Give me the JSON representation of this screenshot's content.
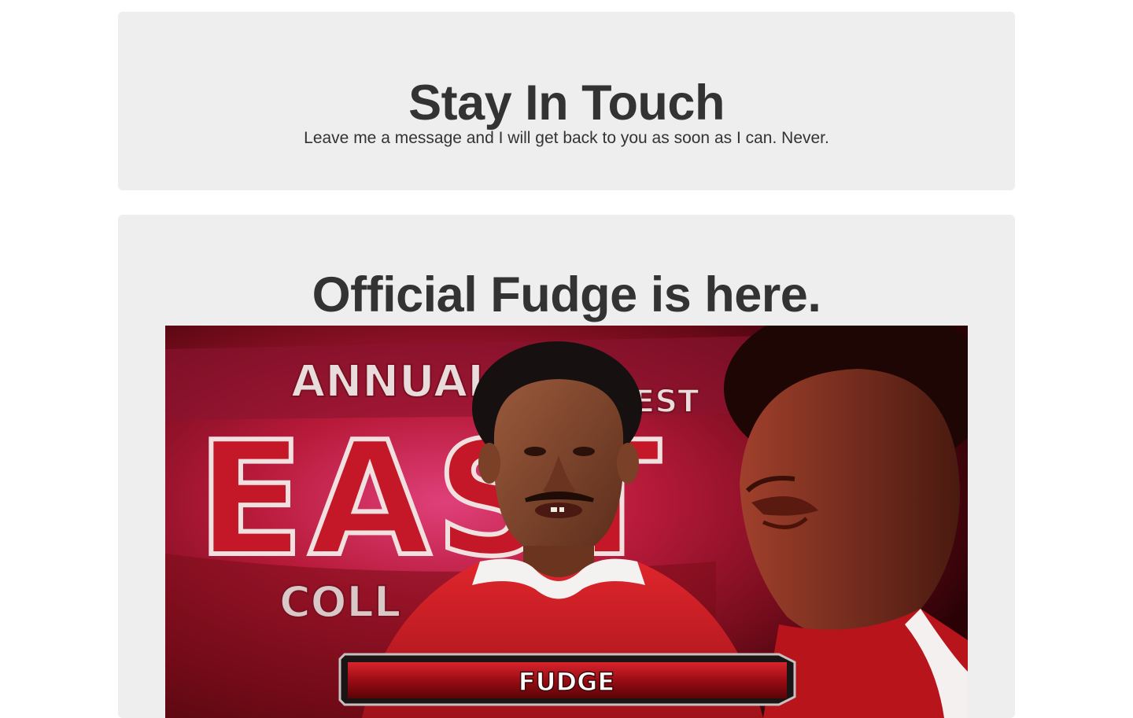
{
  "contact": {
    "title": "Stay In Touch",
    "subtitle": "Leave me a message and I will get back to you as soon as I can. Never."
  },
  "feature": {
    "title": "Official Fudge is here.",
    "video": {
      "backdrop_text_top": "ANNUAL",
      "backdrop_text_top_right": "EST",
      "backdrop_text_big": "EAST",
      "backdrop_text_bottom": "COLL",
      "lower_third_name": "FUDGE"
    }
  },
  "colors": {
    "panel_bg": "#eeeeee",
    "heading": "#333333",
    "video_red": "#b3101d",
    "video_dark": "#3a0508"
  }
}
